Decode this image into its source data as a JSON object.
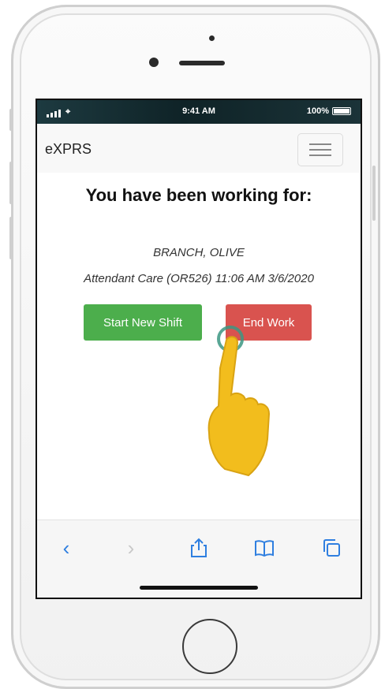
{
  "status_bar": {
    "time": "9:41 AM",
    "battery": "100%"
  },
  "navbar": {
    "brand": "eXPRS"
  },
  "main": {
    "heading": "You have been working for:",
    "client_name": "BRANCH, OLIVE",
    "service_line": "Attendant Care (OR526)  11:06 AM 3/6/2020",
    "start_button": "Start New Shift",
    "end_button": "End Work"
  },
  "colors": {
    "start_button": "#4cae4c",
    "end_button": "#d9534f",
    "toolbar_icons": "#2f7fe0",
    "pointer_hand": "#f2bd1d"
  },
  "toolbar": {
    "icons": [
      "back-icon",
      "forward-icon",
      "share-icon",
      "bookmarks-icon",
      "tabs-icon"
    ]
  }
}
